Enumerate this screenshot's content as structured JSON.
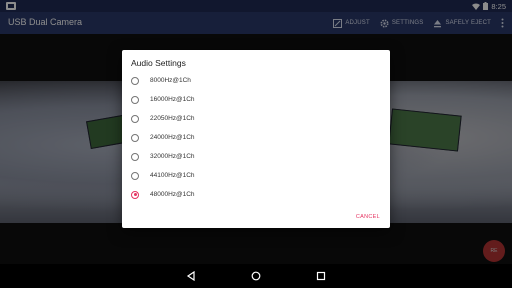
{
  "status_bar": {
    "time": "8:25",
    "icons": [
      "cast-icon",
      "wifi-icon",
      "battery-icon"
    ]
  },
  "app_bar": {
    "title": "USB Dual Camera",
    "actions": [
      {
        "label": "ADJUST",
        "icon": "adjust-icon"
      },
      {
        "label": "SETTINGS",
        "icon": "gear-icon"
      },
      {
        "label": "SAFELY EJECT",
        "icon": "eject-icon"
      }
    ],
    "overflow_icon": "more-vert-icon"
  },
  "dialog": {
    "title": "Audio Settings",
    "options": [
      {
        "label": "8000Hz@1Ch",
        "selected": false
      },
      {
        "label": "16000Hz@1Ch",
        "selected": false
      },
      {
        "label": "22050Hz@1Ch",
        "selected": false
      },
      {
        "label": "24000Hz@1Ch",
        "selected": false
      },
      {
        "label": "32000Hz@1Ch",
        "selected": false
      },
      {
        "label": "44100Hz@1Ch",
        "selected": false
      },
      {
        "label": "48000Hz@1Ch",
        "selected": true
      }
    ],
    "cancel_label": "CANCEL",
    "accent_color": "#e53361"
  },
  "fab": {
    "label": "RE"
  },
  "nav_bar": {
    "buttons": [
      "back-icon",
      "home-icon",
      "recents-icon"
    ]
  }
}
